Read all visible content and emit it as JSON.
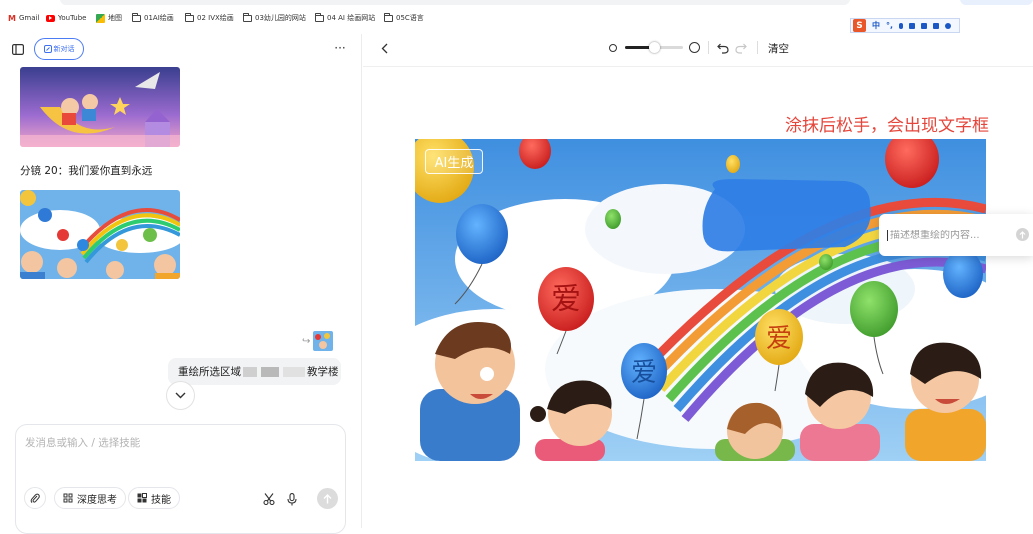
{
  "browser": {
    "bookmarks": [
      {
        "label": "Gmail",
        "icon": "gmail-icon"
      },
      {
        "label": "YouTube",
        "icon": "youtube-icon"
      },
      {
        "label": "地图",
        "icon": "maps-icon"
      },
      {
        "label": "01AI绘画",
        "icon": "folder-icon"
      },
      {
        "label": "02 IVX绘画",
        "icon": "folder-icon"
      },
      {
        "label": "03幼儿园的网站",
        "icon": "folder-icon"
      },
      {
        "label": "04 AI 绘画网站",
        "icon": "folder-icon"
      },
      {
        "label": "05C语言",
        "icon": "folder-icon"
      }
    ],
    "ime": {
      "logo": "S",
      "mode": "中"
    }
  },
  "left_panel": {
    "new_chat_label": "新对话",
    "more_label": "···",
    "caption": "分镜 20：我们爱你直到永远",
    "user_message": {
      "prefix": "重绘所选区域",
      "suffix": "教学楼"
    },
    "composer": {
      "placeholder": "发消息或输入 / 选择技能",
      "deep_think_label": "深度思考",
      "skills_label": "技能"
    }
  },
  "right_panel": {
    "clear_label": "清空",
    "brush_size_fraction": 0.5,
    "hint": "涂抹后松手，会出现文字框",
    "ai_badge": "AI生成",
    "balloon_text": "爱",
    "desc_placeholder": "描述想重绘的内容..."
  },
  "colors": {
    "accent": "#3d6ff2",
    "hint_red": "#e5463b",
    "mask_blue": "#2f7ee6"
  }
}
